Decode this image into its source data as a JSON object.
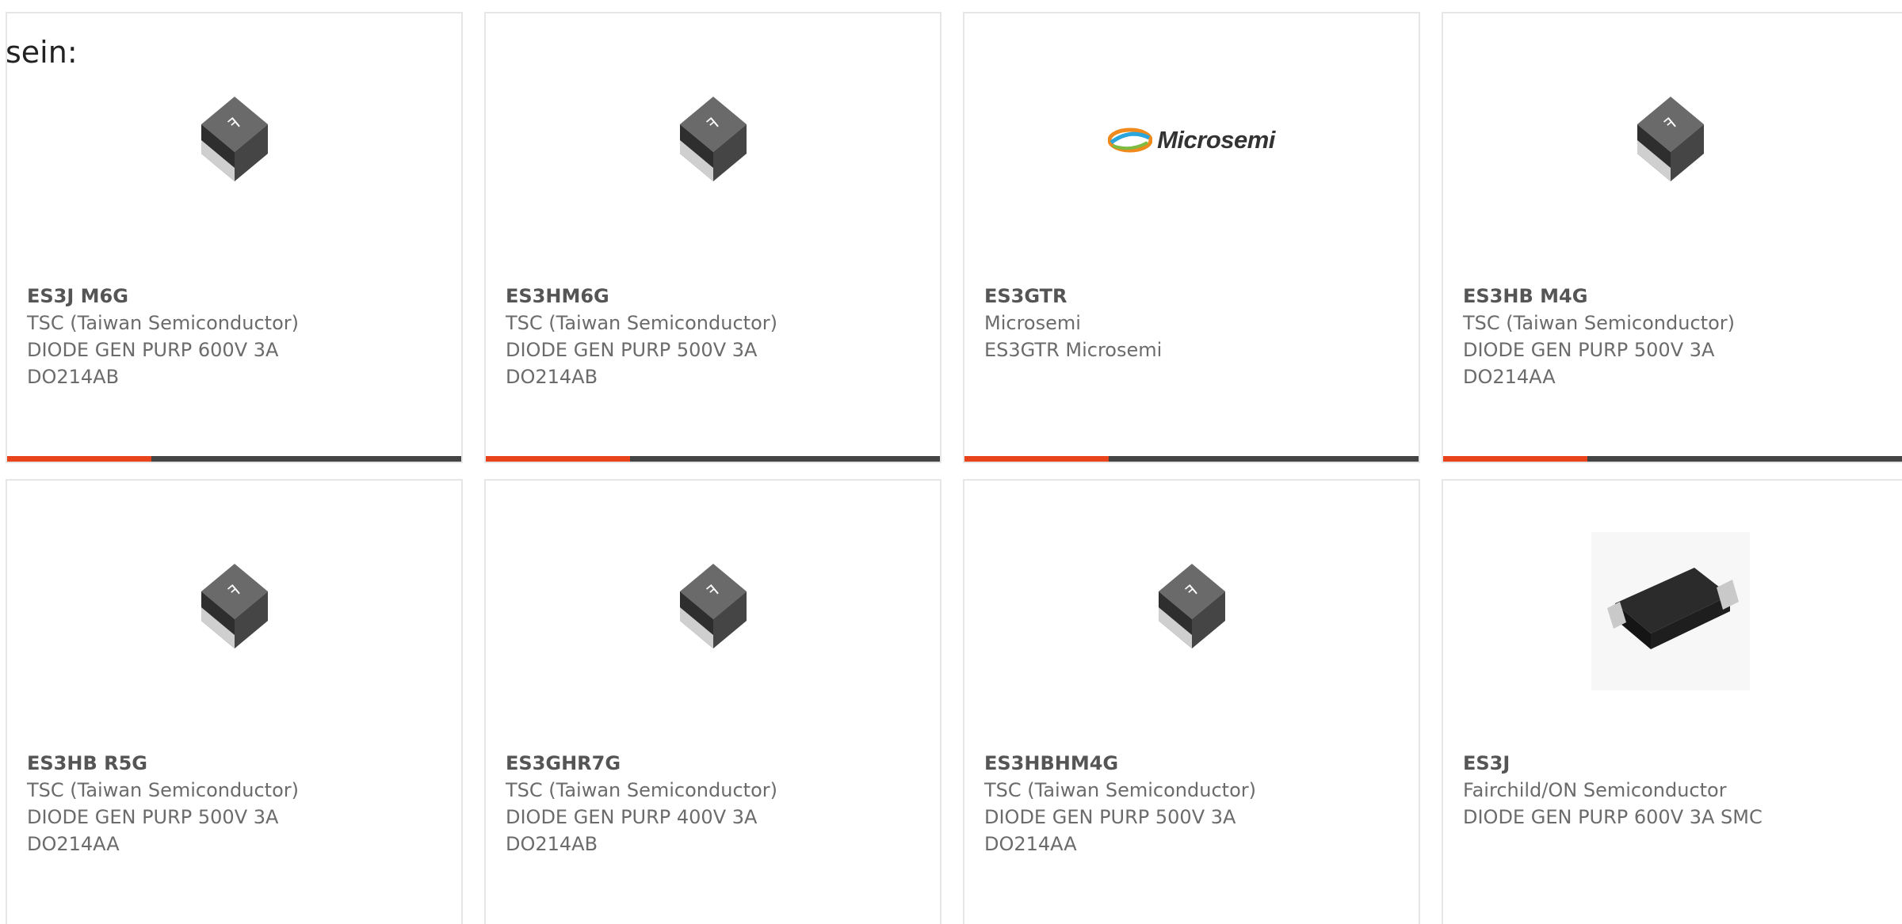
{
  "intro_text": "sein:",
  "colors": {
    "accent": "#e8431b",
    "bar": "#444444",
    "text": "#6b6b6b"
  },
  "products": [
    {
      "part": "ES3J M6G",
      "manufacturer": "TSC (Taiwan Semiconductor)",
      "desc1": "DIODE GEN PURP 600V 3A",
      "desc2": "DO214AB",
      "image": "tsc-smd-package-icon"
    },
    {
      "part": "ES3HM6G",
      "manufacturer": "TSC (Taiwan Semiconductor)",
      "desc1": "DIODE GEN PURP 500V 3A",
      "desc2": "DO214AB",
      "image": "tsc-smd-package-icon"
    },
    {
      "part": "ES3GTR",
      "manufacturer": "Microsemi",
      "desc1": "ES3GTR Microsemi",
      "desc2": "",
      "image": "microsemi-logo",
      "logo_text": "Microsemi"
    },
    {
      "part": "ES3HB M4G",
      "manufacturer": "TSC (Taiwan Semiconductor)",
      "desc1": "DIODE GEN PURP 500V 3A",
      "desc2": "DO214AA",
      "image": "tsc-smd-package-icon"
    },
    {
      "part": "ES3HB R5G",
      "manufacturer": "TSC (Taiwan Semiconductor)",
      "desc1": "DIODE GEN PURP 500V 3A",
      "desc2": "DO214AA",
      "image": "tsc-smd-package-icon"
    },
    {
      "part": "ES3GHR7G",
      "manufacturer": "TSC (Taiwan Semiconductor)",
      "desc1": "DIODE GEN PURP 400V 3A",
      "desc2": "DO214AB",
      "image": "tsc-smd-package-icon"
    },
    {
      "part": "ES3HBHM4G",
      "manufacturer": "TSC (Taiwan Semiconductor)",
      "desc1": "DIODE GEN PURP 500V 3A",
      "desc2": "DO214AA",
      "image": "tsc-smd-package-icon"
    },
    {
      "part": "ES3J",
      "manufacturer": "Fairchild/ON Semiconductor",
      "desc1": "DIODE GEN PURP 600V 3A SMC",
      "desc2": "",
      "image": "smc-package-icon"
    }
  ]
}
